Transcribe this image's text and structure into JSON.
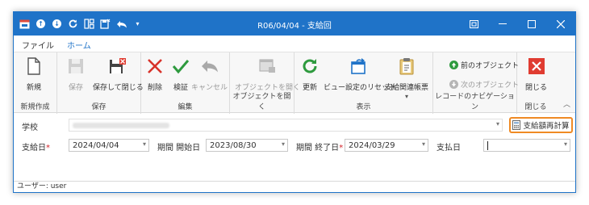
{
  "titlebar": {
    "title": "R06/04/04 - 支給回"
  },
  "tabs": {
    "file": "ファイル",
    "home": "ホーム"
  },
  "ribbon": {
    "new_group": {
      "label": "新規作成",
      "new": "新規"
    },
    "save_group": {
      "label": "保存",
      "save": "保存",
      "save_close": "保存して閉じる"
    },
    "edit_group": {
      "label": "編集",
      "delete": "削除",
      "verify": "検証",
      "cancel": "キャンセル"
    },
    "open_group": {
      "label": "オブジェクトを開く",
      "open": "オブジェクトを開く"
    },
    "view_group": {
      "label": "表示",
      "refresh": "更新",
      "reset_view": "ビュー設定のリセット",
      "report": "支給関連帳票"
    },
    "nav_group": {
      "label": "レコードのナビゲーション",
      "prev": "前のオブジェクト",
      "next": "次のオブジェクト"
    },
    "close_group": {
      "label": "閉じる",
      "close": "閉じる"
    }
  },
  "form": {
    "school_label": "学校",
    "recalc_button": "支給額再計算",
    "pay_date_label": "支給日",
    "pay_date_value": "2024/04/04",
    "period_start_label": "期間 開始日",
    "period_start_value": "2023/08/30",
    "period_end_label": "期間 終了日",
    "period_end_value": "2024/03/29",
    "payment_date_label": "支払日",
    "payment_date_value": ""
  },
  "status": {
    "user": "ユーザー: user"
  },
  "colors": {
    "accent": "#1f73c8",
    "highlight": "#ef8a24",
    "required": "#d2232a"
  }
}
